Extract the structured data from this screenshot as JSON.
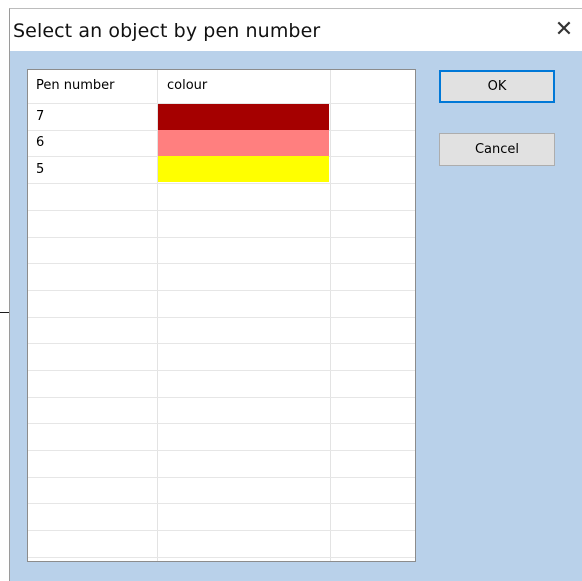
{
  "dialog": {
    "title": "Select an object by pen number",
    "close_glyph": "✕"
  },
  "table": {
    "headers": [
      "Pen number",
      "colour"
    ],
    "rows": [
      {
        "pen": "7",
        "color": "#a50000"
      },
      {
        "pen": "6",
        "color": "#ff7f7f"
      },
      {
        "pen": "5",
        "color": "#ffff00"
      }
    ]
  },
  "buttons": {
    "ok": "OK",
    "cancel": "Cancel"
  }
}
